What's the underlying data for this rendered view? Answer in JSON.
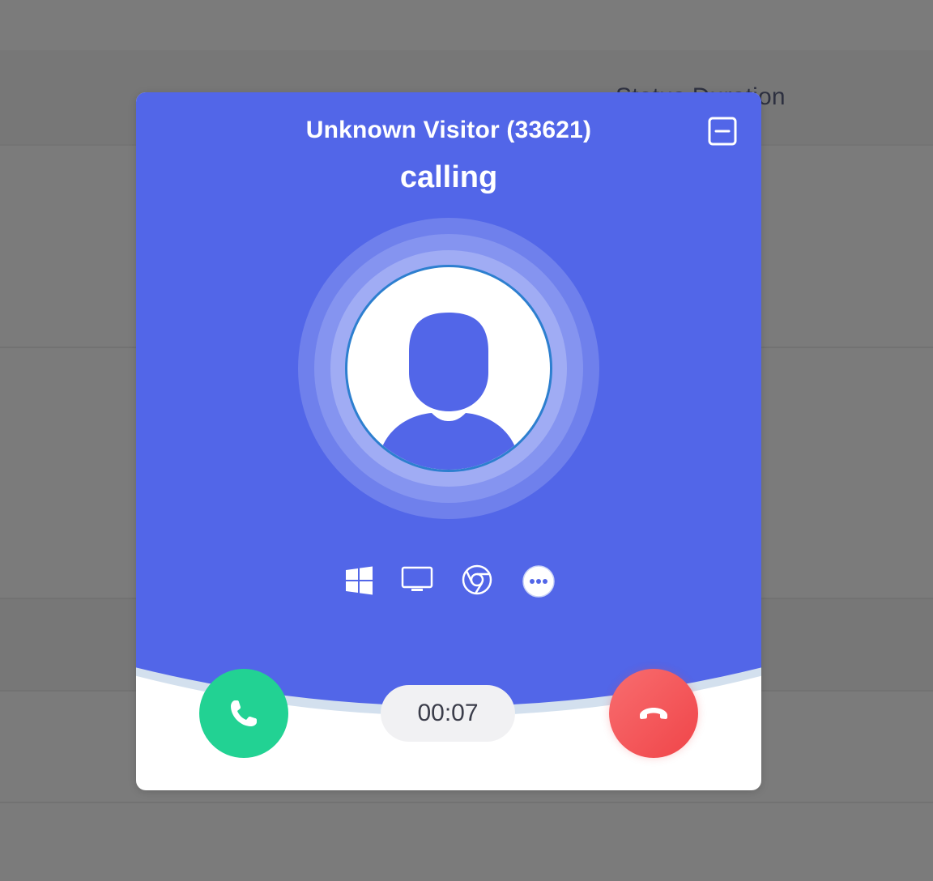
{
  "background": {
    "column_header": "Status   Duration"
  },
  "call": {
    "caller_name": "Unknown Visitor (33621)",
    "status": "calling",
    "timer": "00:07",
    "minimize_icon": "minimize-icon",
    "accept_icon": "phone-icon",
    "decline_icon": "hang-up-icon"
  },
  "device": {
    "icons": [
      "windows-icon",
      "desktop-icon",
      "chrome-icon",
      "more-icon"
    ]
  },
  "colors": {
    "accent": "#5266e8",
    "accept": "#22d293",
    "decline": "#f04549",
    "overlay": "#7b7b7b"
  }
}
